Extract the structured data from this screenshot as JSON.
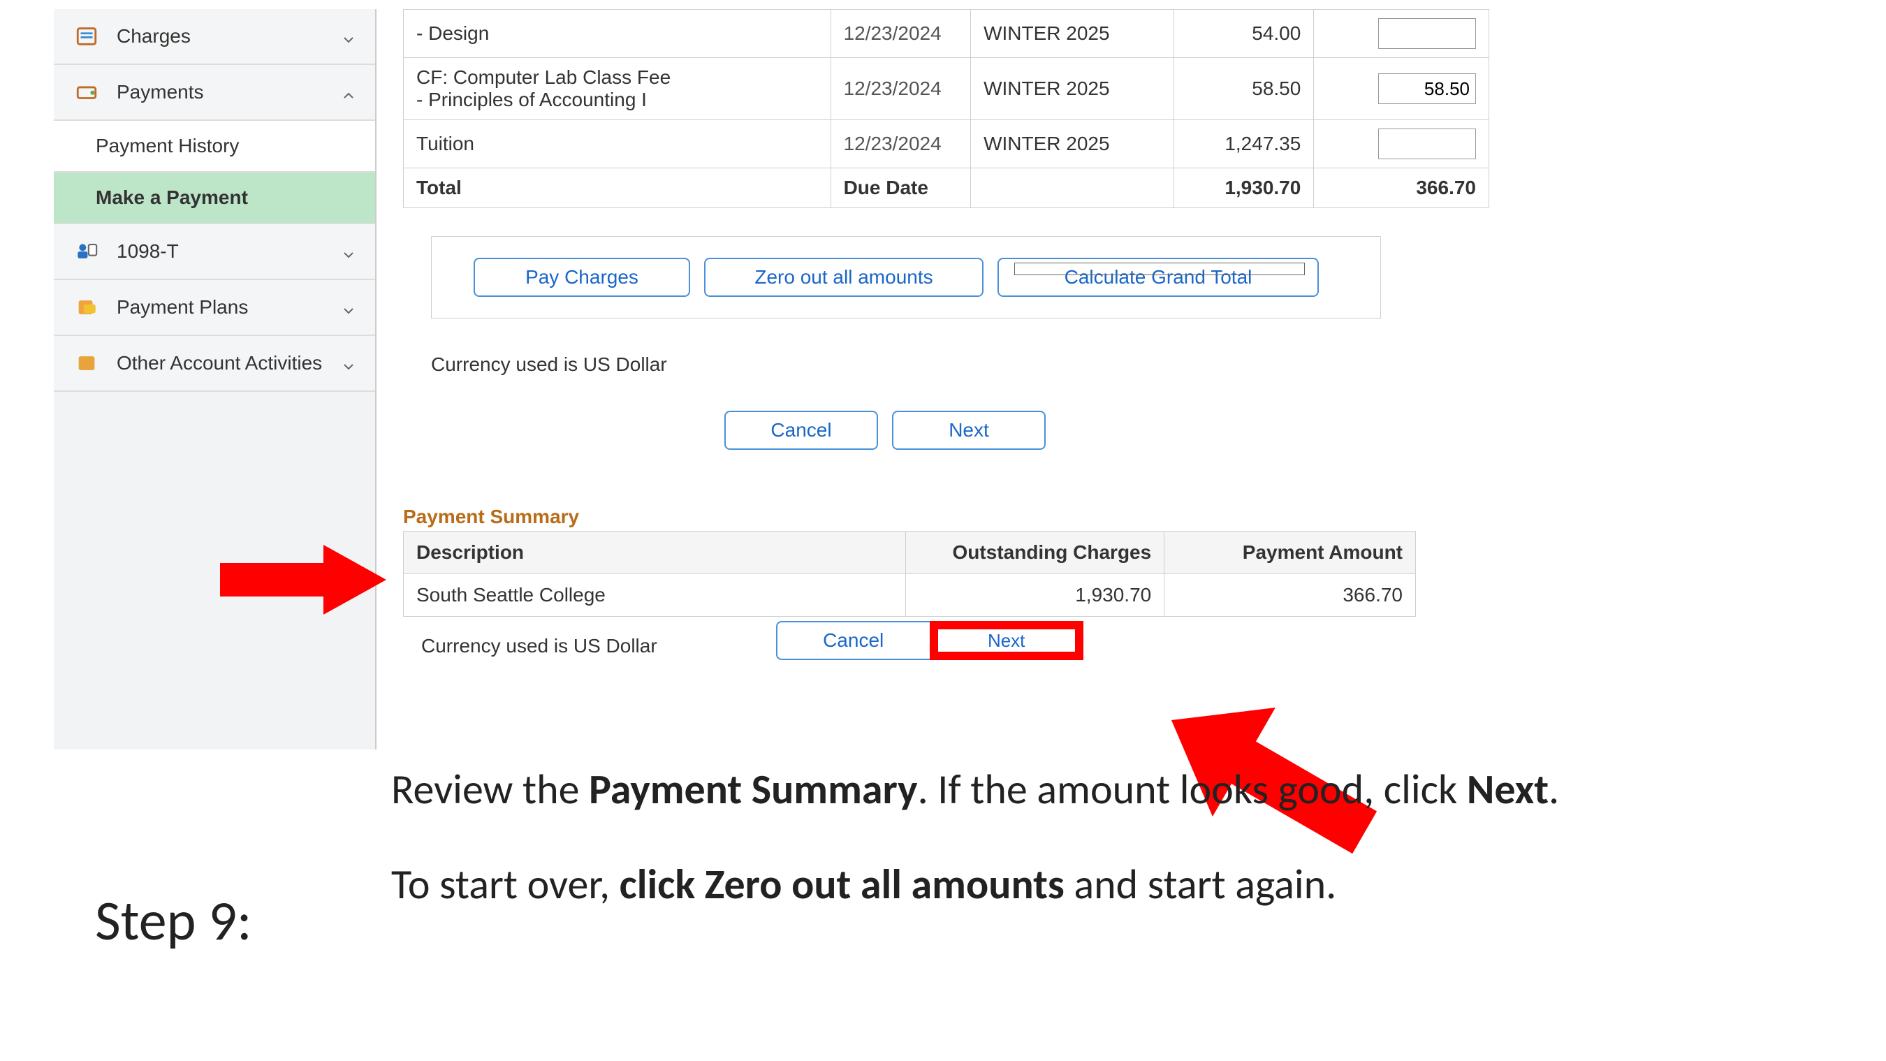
{
  "sidebar": {
    "charges": "Charges",
    "payments": "Payments",
    "payment_history": "Payment History",
    "make_a_payment": "Make a Payment",
    "t1098": "1098-T",
    "payment_plans": "Payment Plans",
    "other_activities": "Other Account Activities"
  },
  "charges_table": {
    "rows": [
      {
        "desc": "-  Design",
        "date": "12/23/2024",
        "term": "WINTER 2025",
        "amount": "54.00",
        "input": ""
      },
      {
        "desc_line1": "CF: Computer Lab Class Fee",
        "desc_line2": "-  Principles of Accounting I",
        "date": "12/23/2024",
        "term": "WINTER 2025",
        "amount": "58.50",
        "input": "58.50"
      },
      {
        "desc": "Tuition",
        "date": "12/23/2024",
        "term": "WINTER 2025",
        "amount": "1,247.35",
        "input": ""
      }
    ],
    "total_label": "Total",
    "due_date_label": "Due Date",
    "total_amount": "1,930.70",
    "total_input": "366.70"
  },
  "buttons": {
    "pay_charges": "Pay Charges",
    "zero_out": "Zero out all amounts",
    "calc_total": "Calculate Grand Total",
    "cancel": "Cancel",
    "next": "Next"
  },
  "currency_note": "Currency used is US Dollar",
  "payment_summary": {
    "title": "Payment Summary",
    "h_desc": "Description",
    "h_outstanding": "Outstanding Charges",
    "h_payment": "Payment Amount",
    "row": {
      "desc": "South Seattle College",
      "outstanding": "1,930.70",
      "payment": "366.70"
    }
  },
  "instructions": {
    "step": "Step 9:",
    "p1_a": "Review the ",
    "p1_b": "Payment Summary",
    "p1_c": ". If the amount looks good, click ",
    "p1_d": "Next",
    "p1_e": ".",
    "p2_a": "To start over, ",
    "p2_b": "click Zero out all amounts",
    "p2_c": " and start again."
  }
}
